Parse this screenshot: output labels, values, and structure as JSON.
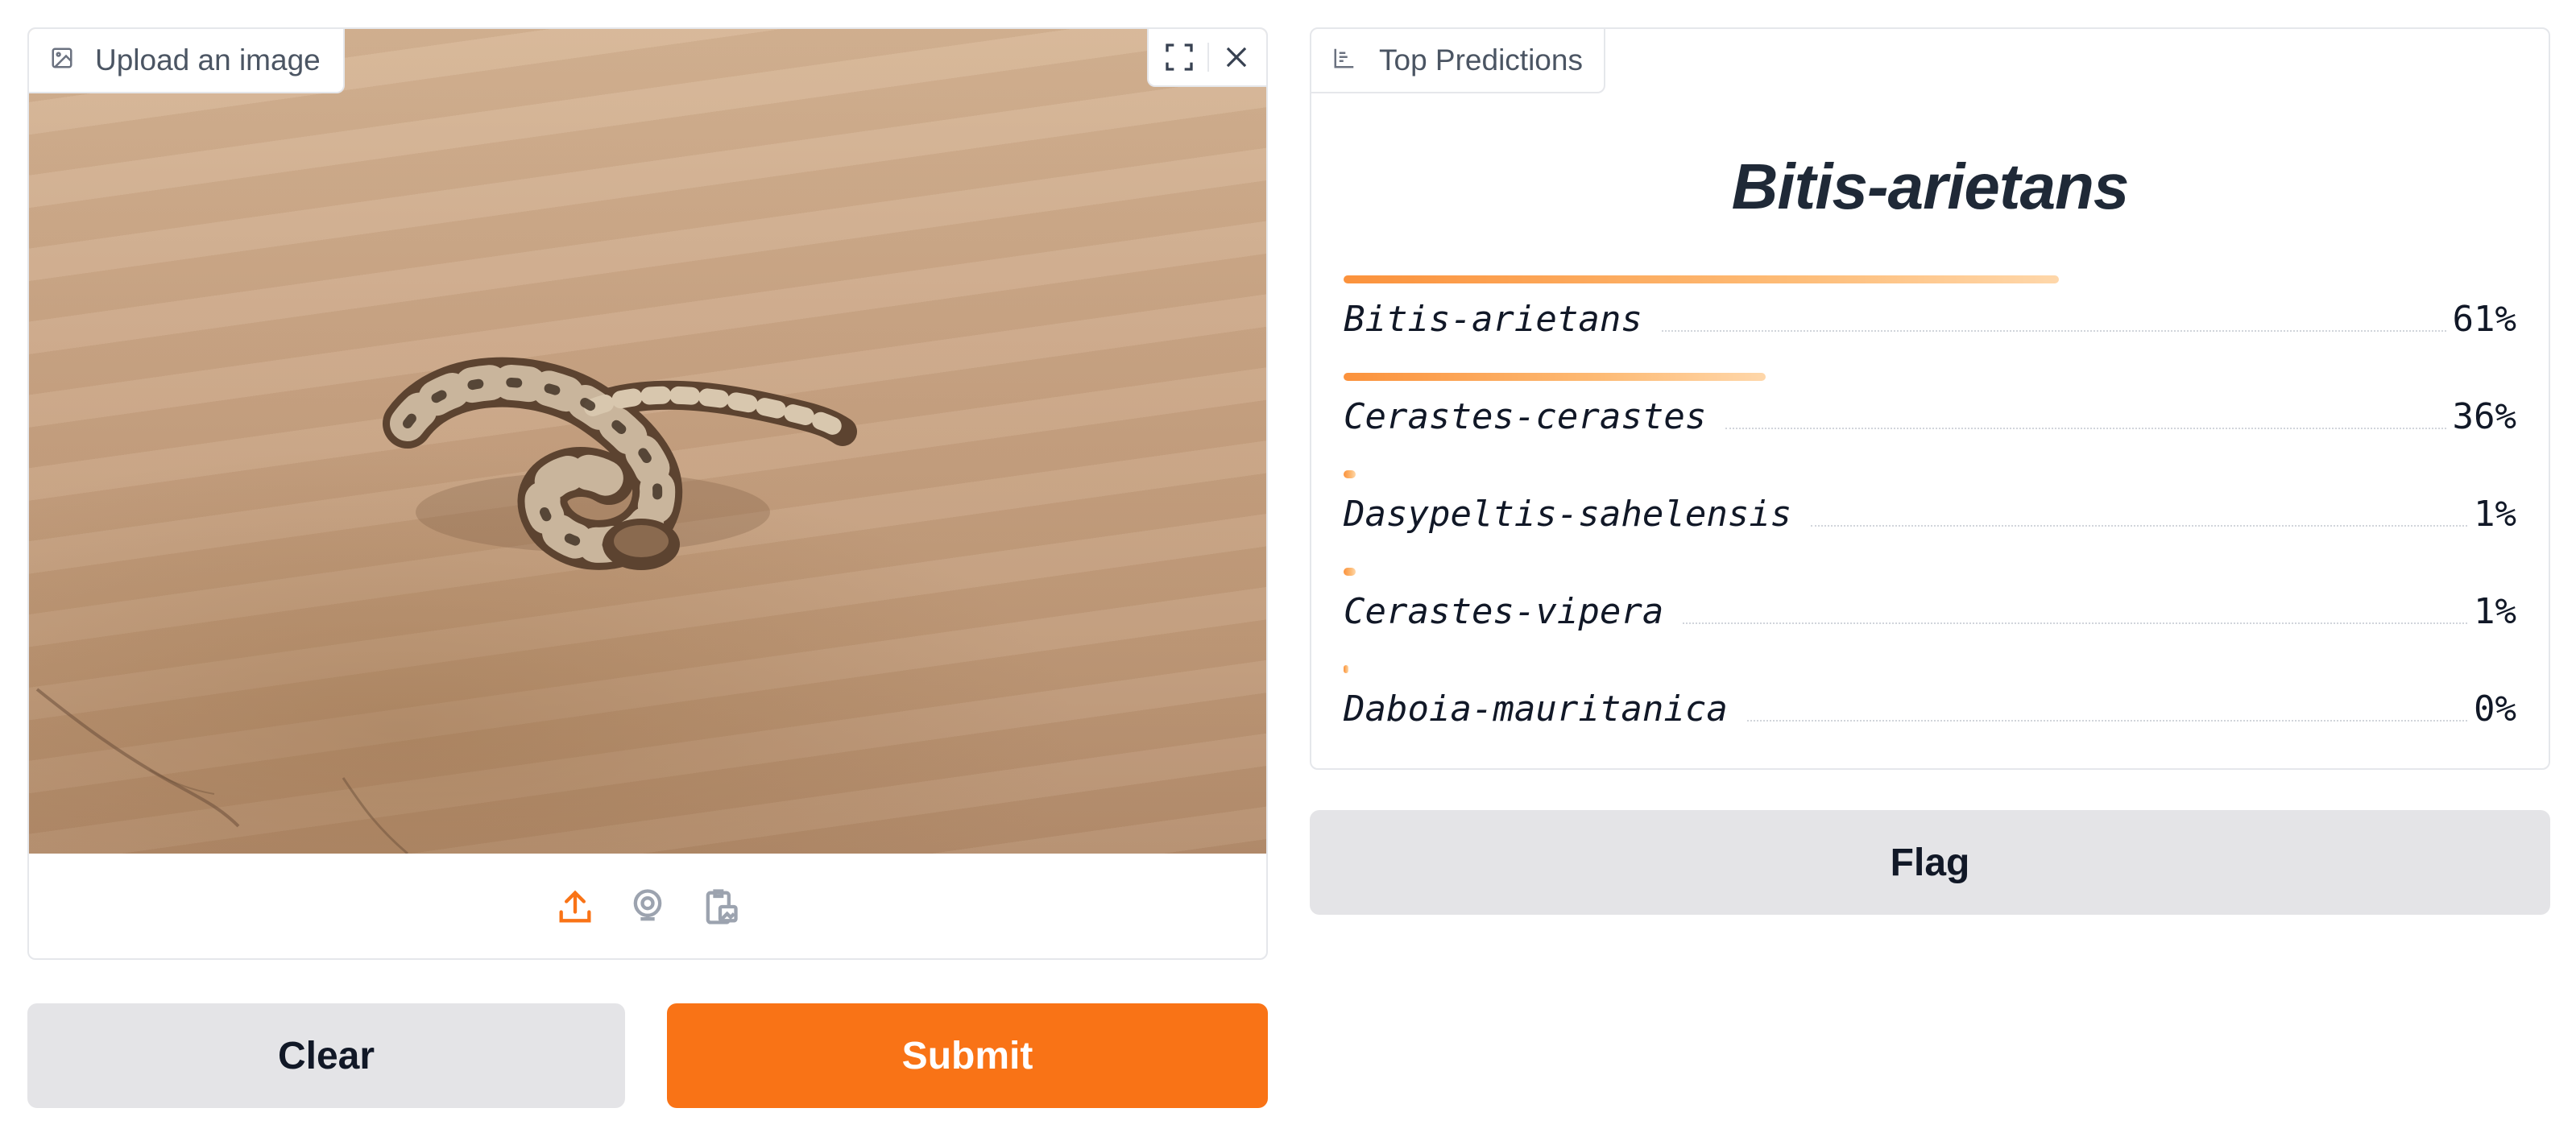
{
  "image_input": {
    "label": "Upload an image",
    "tools": [
      "fullscreen-icon",
      "close-icon"
    ],
    "sources": [
      "upload-icon",
      "webcam-icon",
      "clipboard-icon"
    ],
    "accent_color": "#f97316"
  },
  "buttons": {
    "clear": "Clear",
    "submit": "Submit",
    "flag": "Flag"
  },
  "predictions": {
    "label": "Top Predictions",
    "top_class": "Bitis-arietans",
    "items": [
      {
        "name": "Bitis-arietans",
        "percent": "61%",
        "value": 0.61
      },
      {
        "name": "Cerastes-cerastes",
        "percent": "36%",
        "value": 0.36
      },
      {
        "name": "Dasypeltis-sahelensis",
        "percent": "1%",
        "value": 0.01
      },
      {
        "name": "Cerastes-vipera",
        "percent": "1%",
        "value": 0.01
      },
      {
        "name": "Daboia-mauritanica",
        "percent": "0%",
        "value": 0.0
      }
    ]
  }
}
